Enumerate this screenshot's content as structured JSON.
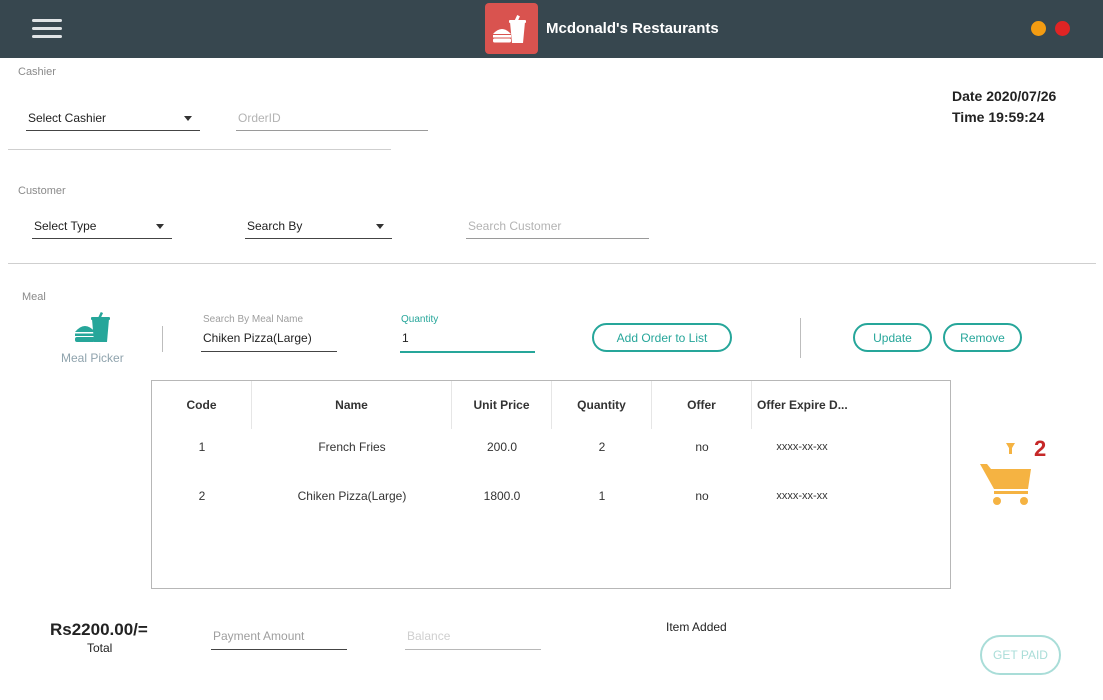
{
  "window": {
    "title": "Mcdonald's Restaurants"
  },
  "colors": {
    "topbar": "#37474f",
    "logo_bg": "#d9534f",
    "accent": "#26a69a",
    "cart": "#f5b342",
    "badge": "#c62828",
    "dot_orange": "#f39c12",
    "dot_red": "#e02424"
  },
  "icons": {
    "menu": "hamburger-menu-icon",
    "logo": "burger-drink-icon",
    "meal_picker": "burger-drink-icon",
    "cart": "shopping-cart-icon"
  },
  "cashier": {
    "section_label": "Cashier",
    "select_cashier": "Select Cashier",
    "order_id_placeholder": "OrderID"
  },
  "datetime": {
    "date": "Date 2020/07/26",
    "time": "Time 19:59:24"
  },
  "customer": {
    "section_label": "Customer",
    "select_type": "Select Type",
    "search_by": "Search By",
    "search_placeholder": "Search Customer"
  },
  "meal": {
    "section_label": "Meal",
    "picker_label": "Meal Picker",
    "search_label": "Search By Meal Name",
    "search_value": "Chiken Pizza(Large)",
    "quantity_label": "Quantity",
    "quantity_value": "1",
    "add_button": "Add Order to List",
    "update_button": "Update",
    "remove_button": "Remove"
  },
  "table": {
    "headers": [
      "Code",
      "Name",
      "Unit Price",
      "Quantity",
      "Offer",
      "Offer Expire D..."
    ],
    "rows": [
      [
        "1",
        "French Fries",
        "200.0",
        "2",
        "no",
        "xxxx-xx-xx"
      ],
      [
        "2",
        "Chiken Pizza(Large)",
        "1800.0",
        "1",
        "no",
        "xxxx-xx-xx"
      ]
    ]
  },
  "cart": {
    "count": "2"
  },
  "footer": {
    "total_amount": "Rs2200.00/=",
    "total_label": "Total",
    "payment_placeholder": "Payment Amount",
    "balance_placeholder": "Balance",
    "status": "Item Added",
    "get_paid": "GET PAID"
  }
}
